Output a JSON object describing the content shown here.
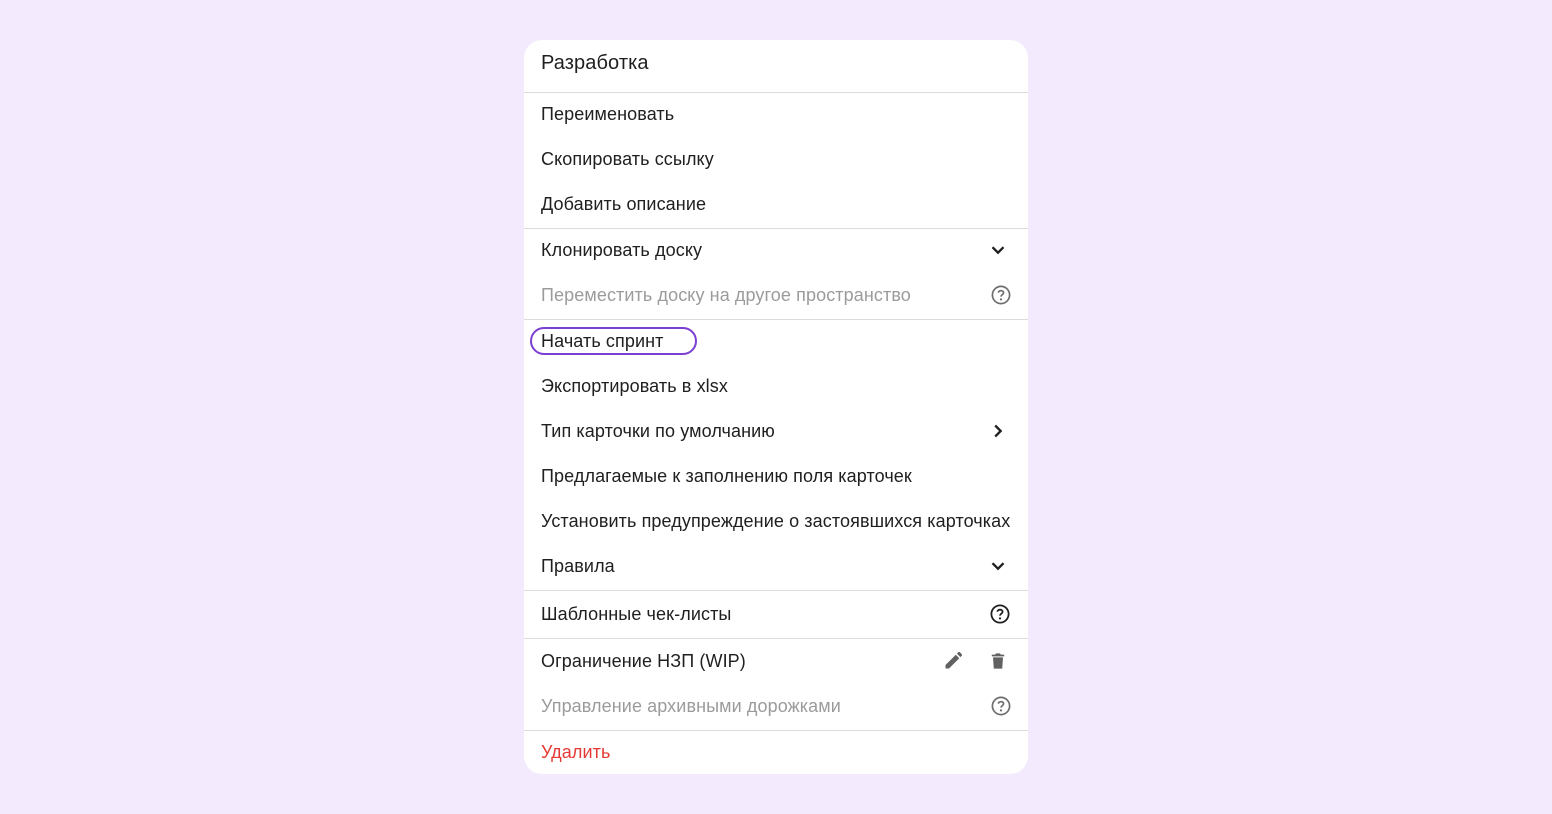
{
  "menu": {
    "title": "Разработка",
    "items": [
      {
        "label": "Переименовать"
      },
      {
        "label": "Скопировать ссылку"
      },
      {
        "label": "Добавить описание"
      },
      {
        "label": "Клонировать доску",
        "icon": "chevron-down-icon"
      },
      {
        "label": "Переместить доску на другое пространство",
        "disabled": true,
        "icon": "help-circle-icon"
      },
      {
        "label": "Начать спринт",
        "highlighted": true
      },
      {
        "label": "Экспортировать в xlsx"
      },
      {
        "label": "Тип карточки по умолчанию",
        "icon": "chevron-right-icon"
      },
      {
        "label": "Предлагаемые к заполнению поля карточек"
      },
      {
        "label": "Установить предупреждение о застоявшихся карточках"
      },
      {
        "label": "Правила",
        "icon": "chevron-down-icon"
      },
      {
        "label": "Шаблонные чек-листы",
        "icon": "help-circle-icon"
      },
      {
        "label": "Ограничение НЗП (WIP)",
        "icons": [
          "pencil-icon",
          "trash-icon"
        ]
      },
      {
        "label": "Управление архивными дорожками",
        "disabled": true,
        "icon": "help-circle-icon"
      },
      {
        "label": "Удалить",
        "danger": true
      }
    ]
  },
  "colors": {
    "background": "#f3ebfd",
    "highlight_outline": "#7b3fd4",
    "danger": "#e53935",
    "disabled_text": "#9b9b9b"
  }
}
